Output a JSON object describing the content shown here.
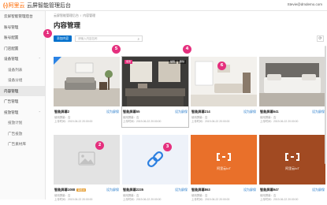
{
  "header": {
    "logo_mark": "(-)",
    "logo_text": "阿里云",
    "app_title": "云屏智能管理后台",
    "account": "Stevie@dmdemo.com"
  },
  "sidebar": {
    "items": [
      {
        "label": "云屏智能管理后台",
        "type": "top"
      },
      {
        "label": "账号管理",
        "type": "top"
      },
      {
        "label": "账号配置",
        "type": "top"
      },
      {
        "label": "门店配置",
        "type": "top"
      },
      {
        "label": "设备管理",
        "type": "top",
        "chevron": "⌃"
      },
      {
        "label": "设备列表",
        "type": "sub"
      },
      {
        "label": "设备分组",
        "type": "sub"
      },
      {
        "label": "内容管理",
        "type": "top",
        "active": true
      },
      {
        "label": "广告管理",
        "type": "top"
      },
      {
        "label": "投放管理",
        "type": "top",
        "chevron": "⌃"
      },
      {
        "label": "投放计划",
        "type": "sub"
      },
      {
        "label": "广告投放",
        "type": "sub"
      },
      {
        "label": "广告素材库",
        "type": "sub"
      }
    ]
  },
  "breadcrumb": [
    "云屏智能管理后台",
    "内容管理"
  ],
  "page_title": "内容管理",
  "toolbar": {
    "upload_label": "添加内容",
    "search_placeholder": "请输入内容名称"
  },
  "cards": [
    {
      "name": "智能屏幕2",
      "action": "设为屏保",
      "meta1": "使用屏幕：否",
      "meta2": "上传时间：2019-06-22 20:00:00",
      "kind": "room-living",
      "corner": true
    },
    {
      "name": "智能屏幕55",
      "action": "设为屏保",
      "meta1": "使用屏幕：否",
      "meta2": "上传时间：2019-06-22 20:00:00",
      "kind": "room-dark",
      "tag_left": "使用",
      "tag_a": "编辑",
      "tag_b": "删除",
      "selected": true
    },
    {
      "name": "智能屏幕214",
      "action": "设为屏保",
      "meta1": "使用屏幕：否",
      "meta2": "上传时间：2019-06-22 20:00:00",
      "kind": "room-bright"
    },
    {
      "name": "智能屏幕641",
      "action": "设为屏保",
      "meta1": "使用屏幕：否",
      "meta2": "上传时间：2019-06-22 20:00:00",
      "kind": "room-bed"
    },
    {
      "name": "智能屏幕1088",
      "badge_tag": "审核中",
      "action": "设为屏保",
      "meta1": "使用屏幕：否",
      "meta2": "上传时间：2019-06-22 20:00:00",
      "kind": "placeholder-image"
    },
    {
      "name": "智能屏幕2235",
      "action": "设为屏保",
      "meta1": "使用屏幕：否",
      "meta2": "上传时间：2019-06-22 20:00:00",
      "kind": "placeholder-link"
    },
    {
      "name": "智能屏幕863",
      "action": "设为屏保",
      "meta1": "使用屏幕：否",
      "meta2": "上传时间：2019-06-22 20:00:00",
      "kind": "orange",
      "brand": "阿里云IoT"
    },
    {
      "name": "智能屏幕947",
      "action": "设为屏保",
      "meta1": "使用屏幕：否",
      "meta2": "上传时间：2019-06-22 20:00:00",
      "kind": "brown",
      "brand": "阿里云IoT"
    }
  ],
  "badges": [
    "1",
    "2",
    "3",
    "4",
    "5",
    "6"
  ],
  "refresh_icon": "⟳",
  "colors": {
    "brand": "#ff6a00",
    "primary": "#0070cc",
    "badge": "#e5307e",
    "orange_tile": "#e9702a",
    "brown_tile": "#a14a22"
  }
}
